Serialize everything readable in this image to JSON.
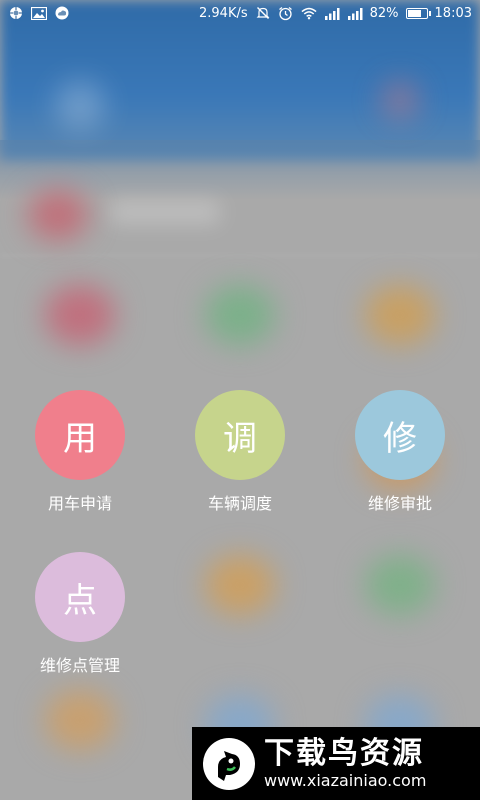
{
  "status_bar": {
    "network_speed": "2.94K/s",
    "battery_percent": "82%",
    "battery_level": 0.82,
    "time": "18:03",
    "left_icons": [
      "sync-icon",
      "image-icon",
      "cloud-icon"
    ],
    "right_icons": [
      "mute-icon",
      "alarm-icon",
      "wifi-icon",
      "signal-icon",
      "signal-icon",
      "battery-icon"
    ]
  },
  "menu": {
    "items": [
      {
        "glyph": "用",
        "label": "用车申请",
        "color": "#f07f8c"
      },
      {
        "glyph": "调",
        "label": "车辆调度",
        "color": "#c6d48c"
      },
      {
        "glyph": "修",
        "label": "维修审批",
        "color": "#9cc8dc"
      },
      {
        "glyph": "点",
        "label": "维修点管理",
        "color": "#dcbcdc"
      }
    ]
  },
  "watermark": {
    "title": "下载鸟资源",
    "url": "www.xiazainiao.com"
  },
  "colors": {
    "header_blue": "#3a78b8",
    "overlay_gray": "#a9a9a9"
  }
}
